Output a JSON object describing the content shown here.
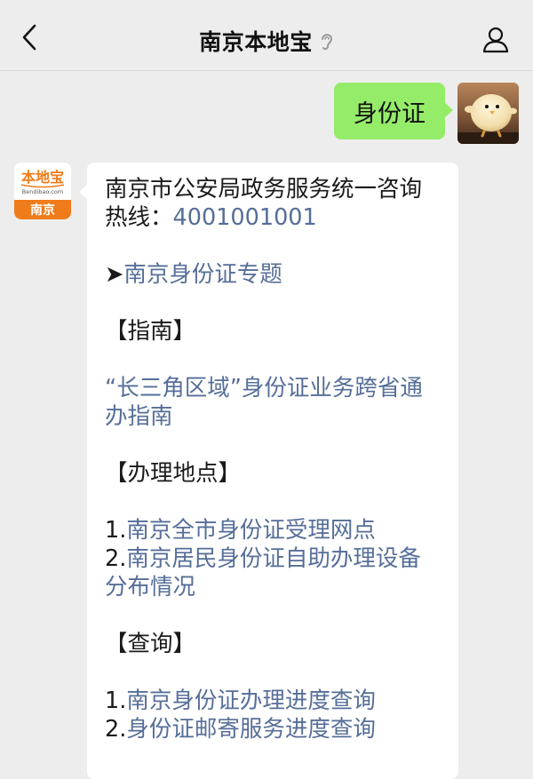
{
  "header": {
    "title": "南京本地宝",
    "back_icon": "chevron-left-icon",
    "earpiece_icon": "ear-icon",
    "profile_icon": "person-icon"
  },
  "outgoing_message": {
    "text": "身份证"
  },
  "bot_avatar": {
    "brand_text": "本地宝",
    "domain_text": "Bendibao.com",
    "city_text": "南京"
  },
  "incoming_message": {
    "hotline_label": "南京市公安局政务服务统一咨询热线：",
    "hotline_number": "4001001001",
    "topic_arrow": "➤",
    "topic_link": "南京身份证专题",
    "guide_heading": "【指南】",
    "guide_link": "“长三角区域”身份证业务跨省通办指南",
    "locations_heading": "【办理地点】",
    "location_items": [
      {
        "prefix": "1.",
        "link": "南京全市身份证受理网点"
      },
      {
        "prefix": "2.",
        "link": "南京居民身份证自助办理设备分布情况"
      }
    ],
    "query_heading": "【查询】",
    "query_items": [
      {
        "prefix": "1.",
        "link": "南京身份证办理进度查询"
      },
      {
        "prefix": "2.",
        "link": "身份证邮寄服务进度查询"
      }
    ]
  },
  "colors": {
    "background": "#ededed",
    "outgoing_bubble": "#95ec69",
    "incoming_bubble": "#ffffff",
    "link": "#566e98",
    "brand_orange": "#f07b1a"
  }
}
